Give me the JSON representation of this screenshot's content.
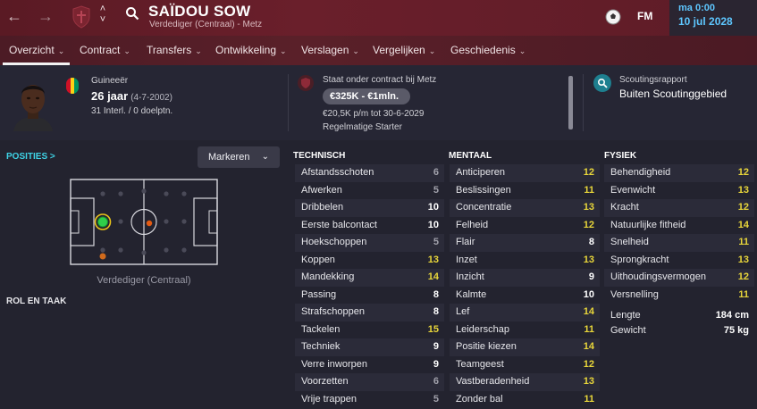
{
  "header": {
    "back_icon": "arrow-left-icon",
    "forward_icon": "arrow-right-icon",
    "player_name": "SAÏDOU SOW",
    "player_subtitle": "Verdediger (Centraal) - Metz",
    "date_day": "ma 0:00",
    "date_full": "10 jul 2028",
    "fm_logo": "FM"
  },
  "tabs": [
    {
      "label": "Overzicht"
    },
    {
      "label": "Contract"
    },
    {
      "label": "Transfers"
    },
    {
      "label": "Ontwikkeling"
    },
    {
      "label": "Verslagen"
    },
    {
      "label": "Vergelijken"
    },
    {
      "label": "Geschiedenis"
    }
  ],
  "profile": {
    "nationality": "Guineeër",
    "age": "26 jaar",
    "dob": "(4-7-2002)",
    "international": "31 Interl. / 0 doelptn.",
    "flag_colors": [
      "#ce1126",
      "#fcd116",
      "#009460"
    ]
  },
  "contract": {
    "title": "Staat onder contract bij Metz",
    "value": "€325K - €1mln.",
    "wage": "€20,5K p/m tot 30-6-2029",
    "status": "Regelmatige Starter"
  },
  "scouting": {
    "title": "Scoutingsrapport",
    "value": "Buiten Scoutinggebied"
  },
  "positions": {
    "label": "POSITIES >",
    "mark_button": "Markeren",
    "caption": "Verdediger (Centraal)",
    "role_label": "ROL EN TAAK"
  },
  "colors": {
    "accent": "#3fd3e6",
    "highlight": "#e8d63a",
    "header": "#5a1a24"
  },
  "attributes": {
    "technical_title": "TECHNISCH",
    "mental_title": "MENTAAL",
    "physical_title": "FYSIEK",
    "technical": [
      {
        "name": "Afstandsschoten",
        "value": "6"
      },
      {
        "name": "Afwerken",
        "value": "5"
      },
      {
        "name": "Dribbelen",
        "value": "10"
      },
      {
        "name": "Eerste balcontact",
        "value": "10"
      },
      {
        "name": "Hoekschoppen",
        "value": "5"
      },
      {
        "name": "Koppen",
        "value": "13"
      },
      {
        "name": "Mandekking",
        "value": "14"
      },
      {
        "name": "Passing",
        "value": "8"
      },
      {
        "name": "Strafschoppen",
        "value": "8"
      },
      {
        "name": "Tackelen",
        "value": "15"
      },
      {
        "name": "Techniek",
        "value": "9"
      },
      {
        "name": "Verre inworpen",
        "value": "9"
      },
      {
        "name": "Voorzetten",
        "value": "6"
      },
      {
        "name": "Vrije trappen",
        "value": "5"
      }
    ],
    "mental": [
      {
        "name": "Anticiperen",
        "value": "12"
      },
      {
        "name": "Beslissingen",
        "value": "11"
      },
      {
        "name": "Concentratie",
        "value": "13"
      },
      {
        "name": "Felheid",
        "value": "12"
      },
      {
        "name": "Flair",
        "value": "8"
      },
      {
        "name": "Inzet",
        "value": "13"
      },
      {
        "name": "Inzicht",
        "value": "9"
      },
      {
        "name": "Kalmte",
        "value": "10"
      },
      {
        "name": "Lef",
        "value": "14"
      },
      {
        "name": "Leiderschap",
        "value": "11"
      },
      {
        "name": "Positie kiezen",
        "value": "14"
      },
      {
        "name": "Teamgeest",
        "value": "12"
      },
      {
        "name": "Vastberadenheid",
        "value": "13"
      },
      {
        "name": "Zonder bal",
        "value": "11"
      }
    ],
    "physical": [
      {
        "name": "Behendigheid",
        "value": "12"
      },
      {
        "name": "Evenwicht",
        "value": "13"
      },
      {
        "name": "Kracht",
        "value": "12"
      },
      {
        "name": "Natuurlijke fitheid",
        "value": "14"
      },
      {
        "name": "Snelheid",
        "value": "11"
      },
      {
        "name": "Sprongkracht",
        "value": "13"
      },
      {
        "name": "Uithoudingsvermogen",
        "value": "12"
      },
      {
        "name": "Versnelling",
        "value": "11"
      }
    ],
    "extra": [
      {
        "name": "Lengte",
        "value": "184 cm"
      },
      {
        "name": "Gewicht",
        "value": "75 kg"
      }
    ]
  }
}
